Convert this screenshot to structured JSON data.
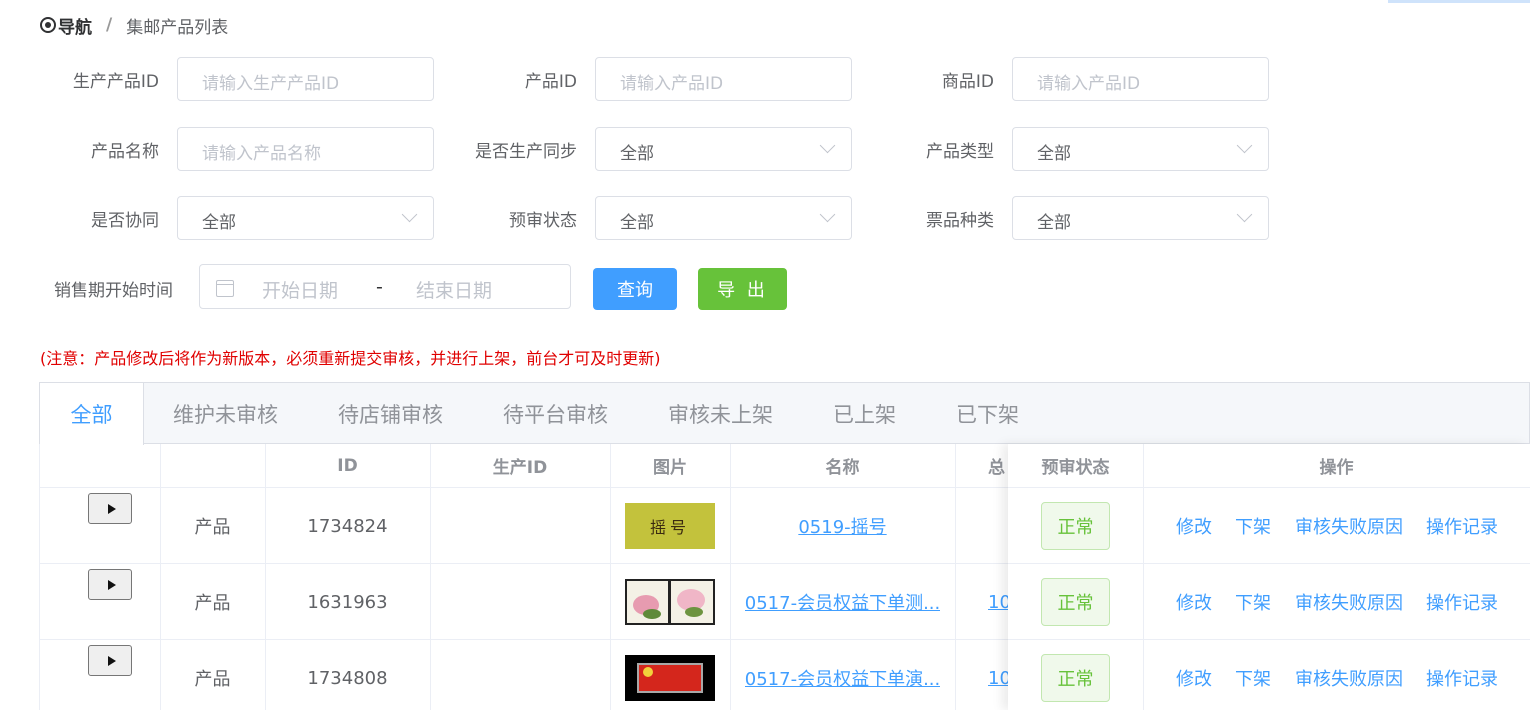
{
  "breadcrumb": {
    "nav": "导航",
    "separator": "/",
    "current": "集邮产品列表"
  },
  "filters": {
    "row1": [
      {
        "label": "生产产品ID",
        "placeholder": "请输入生产产品ID"
      },
      {
        "label": "产品ID",
        "placeholder": "请输入产品ID"
      },
      {
        "label": "商品ID",
        "placeholder": "请输入产品ID"
      }
    ],
    "row2": [
      {
        "label": "产品名称",
        "placeholder": "请输入产品名称"
      },
      {
        "label": "是否生产同步",
        "value": "全部"
      },
      {
        "label": "产品类型",
        "value": "全部"
      }
    ],
    "row3": [
      {
        "label": "是否协同",
        "value": "全部"
      },
      {
        "label": "预审状态",
        "value": "全部"
      },
      {
        "label": "票品种类",
        "value": "全部"
      }
    ],
    "date": {
      "label": "销售期开始时间",
      "start_placeholder": "开始日期",
      "separator": "-",
      "end_placeholder": "结束日期"
    }
  },
  "actions": {
    "query": "查询",
    "export": "导 出"
  },
  "notice": "(注意：产品修改后将作为新版本，必须重新提交审核，并进行上架，前台才可及时更新)",
  "tabs": [
    "全部",
    "维护未审核",
    "待店铺审核",
    "待平台审核",
    "审核未上架",
    "已上架",
    "已下架"
  ],
  "table": {
    "headers": {
      "id": "ID",
      "production_id": "生产ID",
      "image": "图片",
      "name": "名称",
      "total_partial": "总",
      "review_status": "预审状态",
      "operations": "操作"
    },
    "rows": [
      {
        "type": "产品",
        "id": "1734824",
        "production_id": "",
        "thumb_text": "摇号",
        "name": "0519-摇号",
        "total_partial": "",
        "status": "正常"
      },
      {
        "type": "产品",
        "id": "1631963",
        "production_id": "",
        "thumb_text": "",
        "name": "0517-会员权益下单测...",
        "total_partial": "10",
        "status": "正常"
      },
      {
        "type": "产品",
        "id": "1734808",
        "production_id": "",
        "thumb_text": "",
        "name": "0517-会员权益下单演...",
        "total_partial": "10",
        "status": "正常"
      }
    ],
    "ops": {
      "edit": "修改",
      "delist": "下架",
      "fail_reason": "审核失败原因",
      "log": "操作记录"
    }
  },
  "colors": {
    "primary": "#409eff",
    "success": "#67c23a",
    "danger": "#e00000"
  }
}
